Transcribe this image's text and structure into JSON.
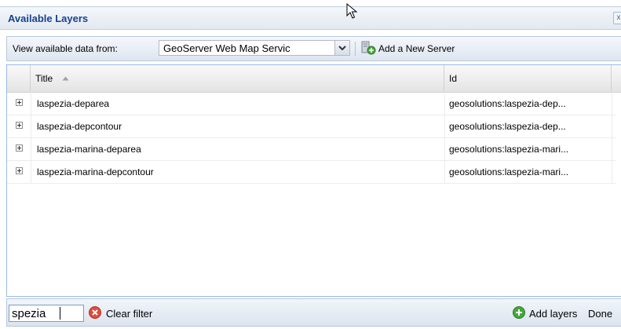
{
  "window": {
    "title": "Available Layers",
    "close_glyph": "x"
  },
  "toolbar": {
    "view_label": "View available data from:",
    "source_value": "GeoServer Web Map Servic",
    "add_server_label": "Add a New Server"
  },
  "grid": {
    "columns": [
      "Title",
      "Id"
    ],
    "rows": [
      {
        "title": "laspezia-deparea",
        "id": "geosolutions:laspezia-dep..."
      },
      {
        "title": "laspezia-depcontour",
        "id": "geosolutions:laspezia-dep..."
      },
      {
        "title": "laspezia-marina-deparea",
        "id": "geosolutions:laspezia-mari..."
      },
      {
        "title": "laspezia-marina-depcontour",
        "id": "geosolutions:laspezia-mari..."
      }
    ]
  },
  "bottom": {
    "filter_value": "spezia",
    "clear_filter_label": "Clear filter",
    "add_layers_label": "Add layers",
    "done_label": "Done"
  },
  "icons": {
    "expander": "plus-expander-icon",
    "sort": "sort-ascending-icon",
    "add_server": "add-server-icon",
    "clear": "clear-filter-icon",
    "add_layers": "add-icon",
    "dropdown": "chevron-down-icon",
    "cursor": "mouse-cursor-icon"
  },
  "colors": {
    "title_text": "#15428b",
    "clear_red": "#e04b3c",
    "add_green": "#45a83a",
    "grid_border": "#99bbe8"
  }
}
